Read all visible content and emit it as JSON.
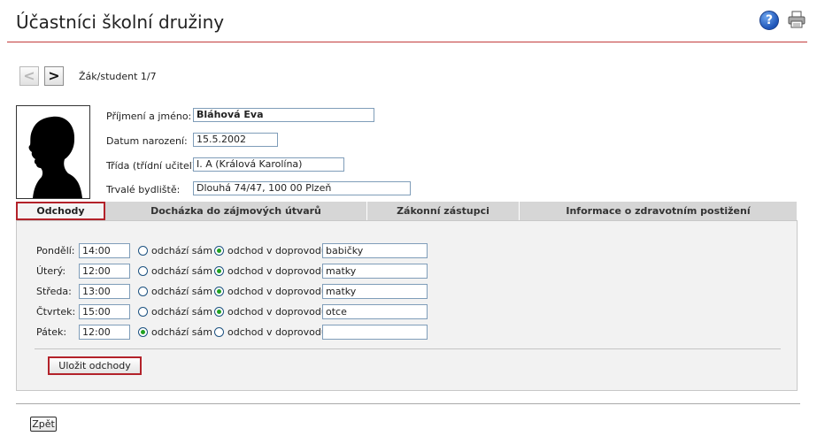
{
  "page": {
    "title": "Účastníci školní družiny"
  },
  "nav": {
    "prev": "<",
    "next": ">",
    "counter": "Žák/student 1/7"
  },
  "student": {
    "name_label": "Příjmení a jméno:",
    "name_value": "Bláhová Eva",
    "birth_label": "Datum narození:",
    "birth_value": "15.5.2002",
    "class_label": "Třída (třídní učitel):",
    "class_value": "I. A (Králová Karolína)",
    "address_label": "Trvalé bydliště:",
    "address_value": "Dlouhá 74/47, 100 00 Plzeň"
  },
  "tabs": [
    {
      "label": "Odchody",
      "active": true
    },
    {
      "label": "Docházka do zájmových útvarů",
      "active": false
    },
    {
      "label": "Zákonní zástupci",
      "active": false
    },
    {
      "label": "Informace o zdravotním postižení",
      "active": false
    }
  ],
  "departures": {
    "option_alone": "odchází sám",
    "option_escort": "odchod v doprovodu",
    "rows": [
      {
        "day": "Pondělí:",
        "time": "14:00",
        "mode": "escort",
        "escort": "babičky"
      },
      {
        "day": "Úterý:",
        "time": "12:00",
        "mode": "escort",
        "escort": "matky"
      },
      {
        "day": "Středa:",
        "time": "13:00",
        "mode": "escort",
        "escort": "matky"
      },
      {
        "day": "Čtvrtek:",
        "time": "15:00",
        "mode": "escort",
        "escort": "otce"
      },
      {
        "day": "Pátek:",
        "time": "12:00",
        "mode": "alone",
        "escort": ""
      }
    ],
    "save_label": "Uložit odchody"
  },
  "footer": {
    "back_label": "Zpět"
  },
  "icons": {
    "help": "help-icon",
    "print": "printer-icon",
    "help_glyph": "?"
  },
  "colors": {
    "accent": "#b3222a",
    "checked_radio": "#21a121",
    "input_border": "#7f9db9"
  }
}
